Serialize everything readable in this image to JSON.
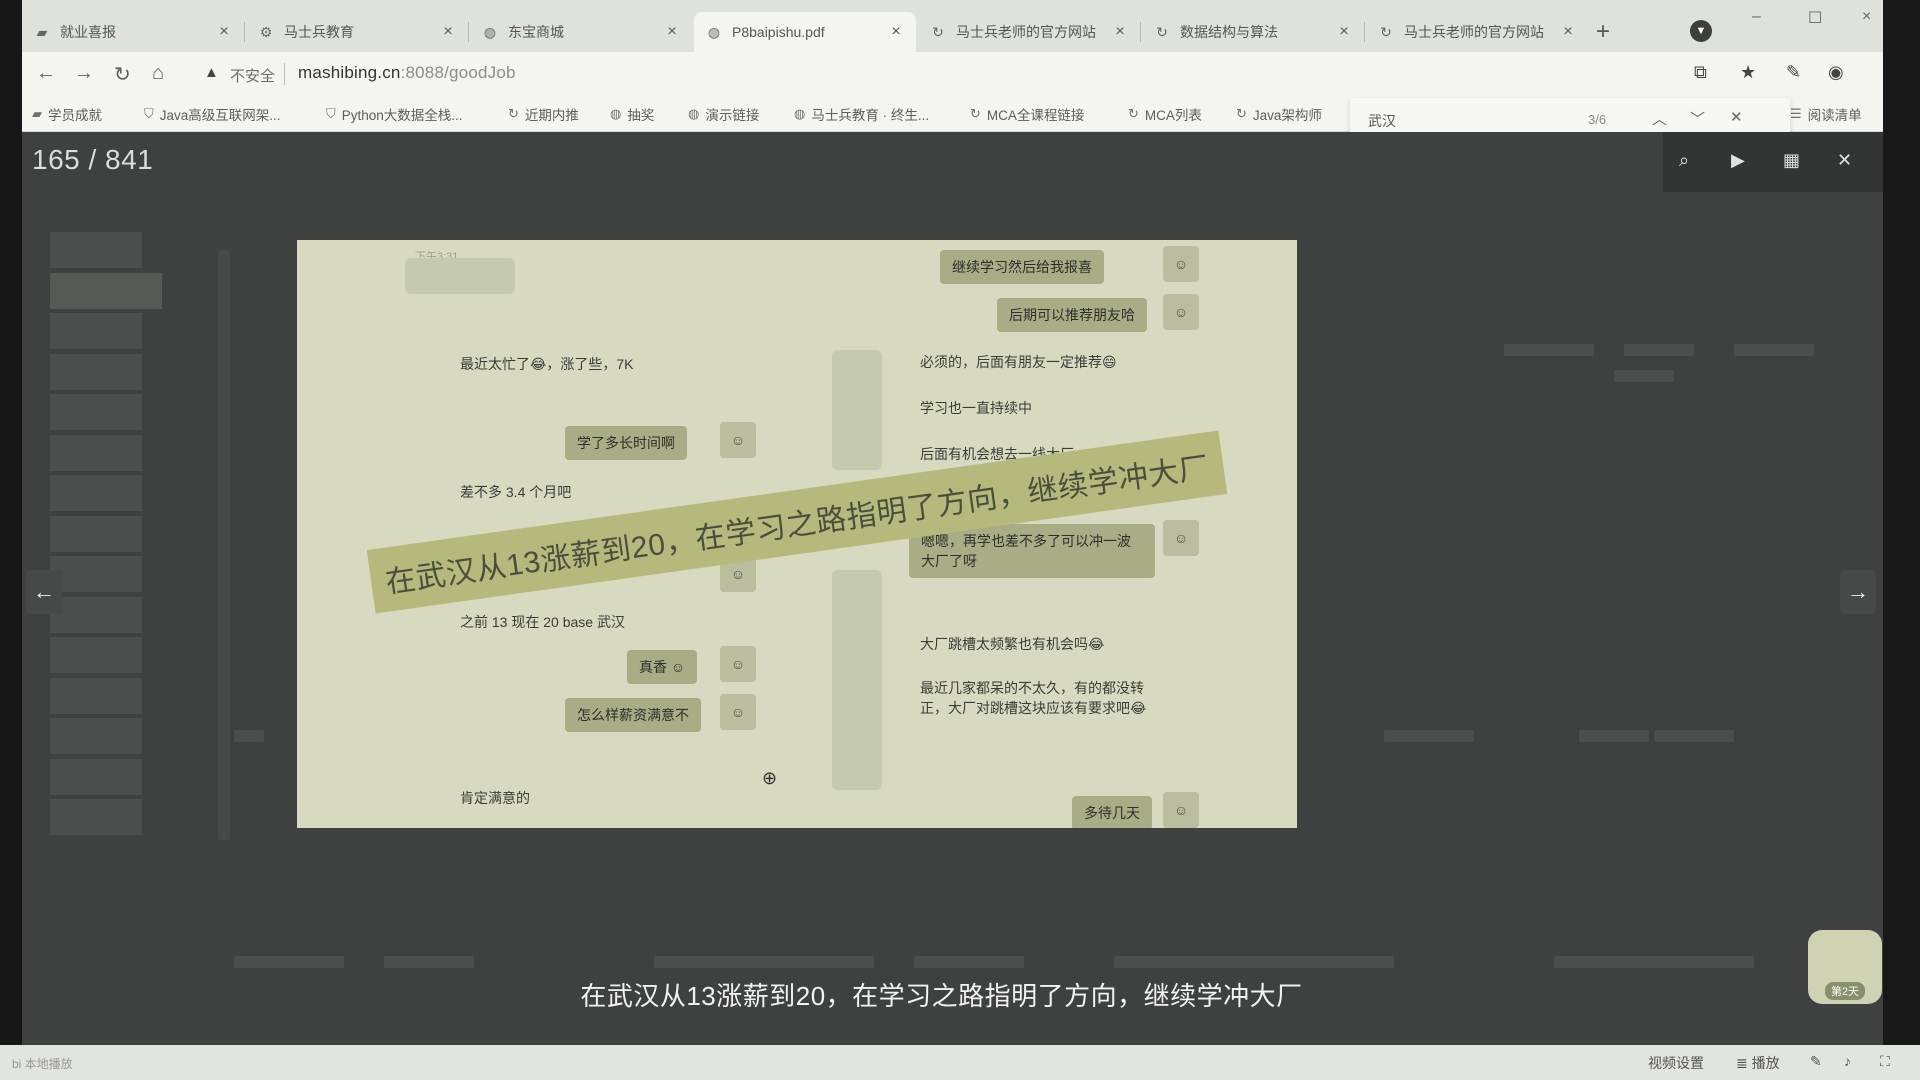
{
  "browser": {
    "tabs": [
      {
        "title": "就业喜报",
        "icon": "folder-icon",
        "active": false
      },
      {
        "title": "马士兵教育",
        "icon": "site-icon",
        "active": false
      },
      {
        "title": "东宝商城",
        "icon": "globe-icon",
        "active": false
      },
      {
        "title": "P8baipishu.pdf",
        "icon": "globe-icon",
        "active": true
      },
      {
        "title": "马士兵老师的官方网站",
        "icon": "refresh-icon",
        "active": false
      },
      {
        "title": "数据结构与算法",
        "icon": "refresh-icon",
        "active": false
      },
      {
        "title": "马士兵老师的官方网站",
        "icon": "refresh-icon",
        "active": false
      }
    ],
    "close_glyph": "×",
    "new_tab": "+",
    "window_controls": {
      "minimize": "–",
      "maximize": "☐",
      "close": "×"
    },
    "address": {
      "insecure_label": "不安全",
      "url_host": "mashibing.cn",
      "url_path": ":8088/goodJob"
    },
    "bookmarks": [
      {
        "label": "学员成就",
        "icon": "folder-icon"
      },
      {
        "label": "Java高级互联网架...",
        "icon": "shield-icon"
      },
      {
        "label": "Python大数据全栈...",
        "icon": "shield-icon"
      },
      {
        "label": "近期内推",
        "icon": "refresh-icon"
      },
      {
        "label": "抽奖",
        "icon": "globe-icon"
      },
      {
        "label": "演示链接",
        "icon": "globe-icon"
      },
      {
        "label": "马士兵教育 · 终生...",
        "icon": "globe-icon"
      },
      {
        "label": "MCA全课程链接",
        "icon": "refresh-icon"
      },
      {
        "label": "MCA列表",
        "icon": "refresh-icon"
      },
      {
        "label": "Java架构师",
        "icon": "refresh-icon"
      }
    ],
    "reading_list": "阅读清单",
    "find": {
      "query": "武汉",
      "count": "3/6"
    }
  },
  "viewer": {
    "page_current": 165,
    "page_total": 841,
    "page_indicator": "165 / 841",
    "prev": "←",
    "next": "→"
  },
  "slide": {
    "time_left": "下午3:31",
    "chat_left": [
      {
        "type": "plain",
        "text": "最近太忙了😂，涨了些，7K"
      },
      {
        "type": "bubble",
        "text": "学了多长时间啊"
      },
      {
        "type": "plain",
        "text": "差不多 3.4 个月吧"
      },
      {
        "type": "plain",
        "text": "之前 13 现在 20 base 武汉"
      },
      {
        "type": "bubble",
        "text": "真香 ☺"
      },
      {
        "type": "bubble",
        "text": "怎么样薪资满意不"
      },
      {
        "type": "plain",
        "text": "肯定满意的"
      }
    ],
    "chat_right": [
      {
        "type": "bubble",
        "text": "继续学习然后给我报喜"
      },
      {
        "type": "bubble",
        "text": "后期可以推荐朋友哈"
      },
      {
        "type": "plain",
        "text": "必须的，后面有朋友一定推荐😄"
      },
      {
        "type": "plain",
        "text": "学习也一直持续中"
      },
      {
        "type": "plain",
        "text": "后面有机会想去一线大厂"
      },
      {
        "type": "bubble",
        "text": "嗯嗯，再学也差不多了可以冲一波大厂了呀"
      },
      {
        "type": "plain",
        "text": "大厂跳槽太频繁也有机会吗😂"
      },
      {
        "type": "plain",
        "text": "最近几家都呆的不太久，有的都没转正，大厂对跳槽这块应该有要求吧😂"
      },
      {
        "type": "bubble",
        "text": "多待几天"
      }
    ],
    "banner": "在武汉从13涨薪到20，在学习之路指明了方向，继续学冲大厂"
  },
  "subtitle": "在武汉从13涨薪到20，在学习之路指明了方向，继续学冲大厂",
  "mascot_label": "第2天",
  "statusbar": {
    "left": "bi 本地播放",
    "video_settings": "视频设置",
    "list": "≣ 播放"
  }
}
